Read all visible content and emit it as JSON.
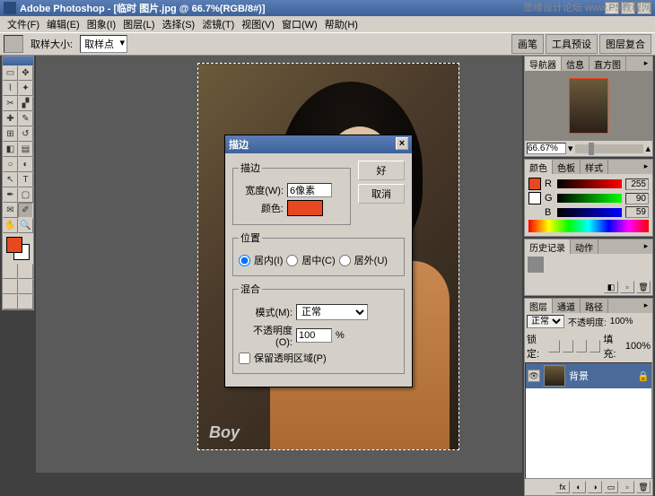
{
  "app": {
    "title": "Adobe Photoshop - [临时 图片.jpg @ 66.7%(RGB/8#)]"
  },
  "menu": {
    "file": "文件(F)",
    "edit": "编辑(E)",
    "image": "图象(I)",
    "layer": "图层(L)",
    "select": "选择(S)",
    "filter": "滤镜(T)",
    "view": "视图(V)",
    "window": "窗口(W)",
    "help": "帮助(H)"
  },
  "options": {
    "sample_size": "取样大小:",
    "sample_point": "取样点"
  },
  "righttabs": {
    "brush": "画笔",
    "presets": "工具预设",
    "layercomps": "图层复合"
  },
  "nav": {
    "tab1": "导航器",
    "tab2": "信息",
    "tab3": "直方图",
    "zoom": "66.67%"
  },
  "color": {
    "tab1": "颜色",
    "tab2": "色板",
    "tab3": "样式",
    "r": "R",
    "g": "G",
    "b": "B",
    "rv": "255",
    "gv": "90",
    "bv": "59"
  },
  "history": {
    "tab1": "历史记录",
    "tab2": "动作"
  },
  "layers": {
    "tab1": "图层",
    "tab2": "通道",
    "tab3": "路径",
    "blend": "正常",
    "opacity_lbl": "不透明度:",
    "opacity": "100%",
    "lock": "锁定:",
    "fill_lbl": "填充:",
    "fill": "100%",
    "bg": "背景"
  },
  "dialog": {
    "title": "描边",
    "ok": "好",
    "cancel": "取消",
    "stroke_group": "描边",
    "width_label": "宽度(W):",
    "width_value": "6像素",
    "color_label": "颜色:",
    "location_group": "位置",
    "loc_inside": "居内(I)",
    "loc_center": "居中(C)",
    "loc_outside": "居外(U)",
    "blend_group": "混合",
    "mode_label": "模式(M):",
    "mode_value": "正常",
    "opacity_label": "不透明度(O):",
    "opacity_value": "100",
    "opacity_pct": "%",
    "preserve": "保留透明区域(P)"
  },
  "canvas": {
    "watermark": "Boy"
  },
  "topwm": "思缘设计论坛  www.PS教程网"
}
